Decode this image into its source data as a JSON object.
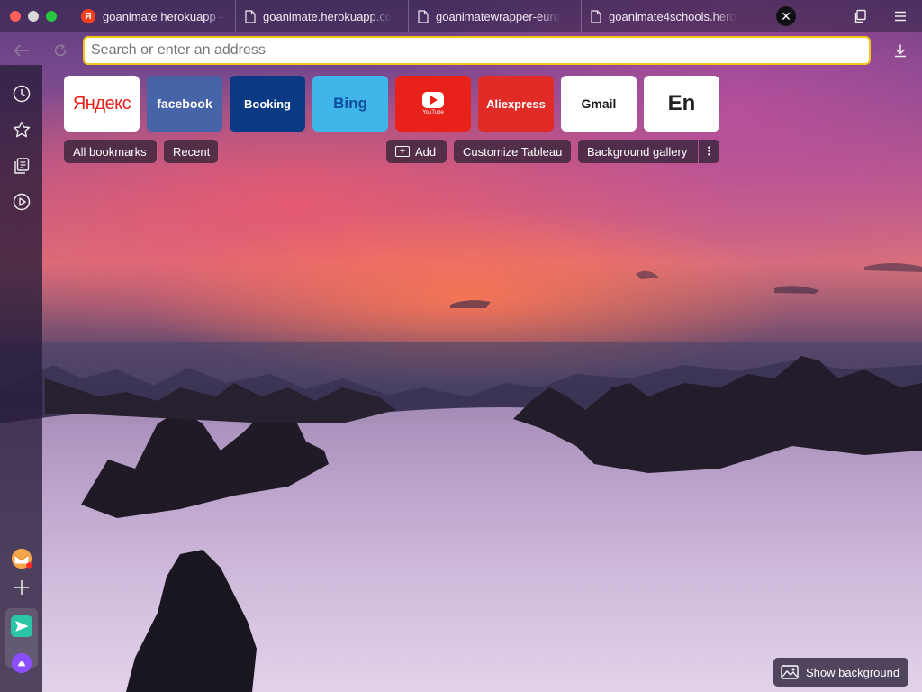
{
  "window": {
    "tabs": [
      {
        "title": "goanimate herokuapp —",
        "icon": "yandex-favicon"
      },
      {
        "title": "goanimate.herokuapp.co",
        "icon": "document-icon"
      },
      {
        "title": "goanimatewrapper-euro",
        "icon": "document-icon"
      },
      {
        "title": "goanimate4schools.hero",
        "icon": "document-icon"
      }
    ],
    "yandex_favicon_letter": "Я"
  },
  "address_bar": {
    "placeholder": "Search or enter an address",
    "focus_color": "#f5c51a"
  },
  "tiles": [
    {
      "label": "Яндекс",
      "bg": "#ffffff"
    },
    {
      "label": "facebook",
      "bg": "#4864a8"
    },
    {
      "label": "Booking",
      "bg": "#0b3a84"
    },
    {
      "label": "Bing",
      "bg": "#3fb5ea"
    },
    {
      "label": "YouTube",
      "bg": "#e8221b"
    },
    {
      "label": "Aliexpress",
      "bg": "#e02b27"
    },
    {
      "label": "Gmail",
      "bg": "#ffffff"
    },
    {
      "label": "En",
      "bg": "#ffffff"
    }
  ],
  "actions": {
    "all_bookmarks": "All bookmarks",
    "recent": "Recent",
    "add": "Add",
    "customize": "Customize Tableau",
    "gallery": "Background gallery",
    "more": "⋮"
  },
  "show_background": "Show background"
}
